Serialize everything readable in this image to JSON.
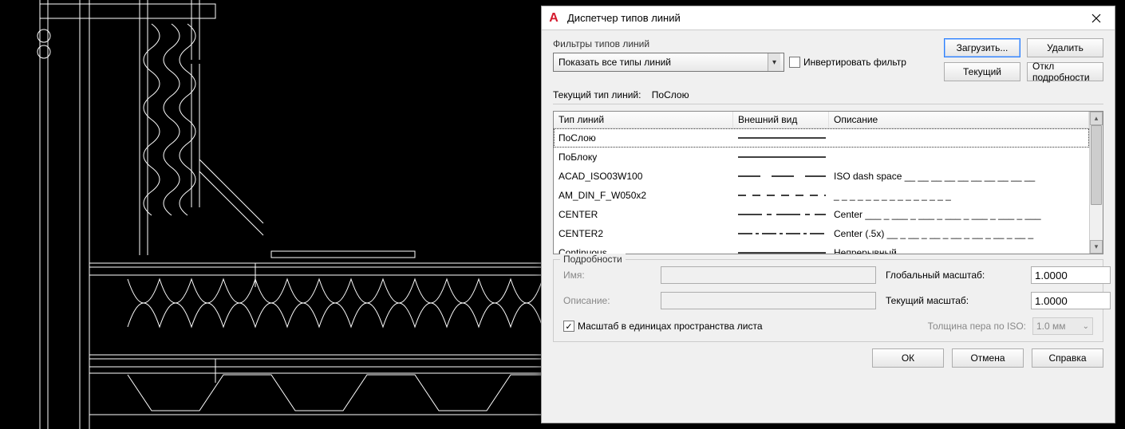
{
  "window": {
    "title": "Диспетчер типов линий",
    "app_icon_letter": "A"
  },
  "filters": {
    "group_label": "Фильтры типов линий",
    "selected": "Показать все типы линий",
    "invert_label": "Инвертировать фильтр",
    "invert_checked": false
  },
  "top_buttons": {
    "load": "Загрузить...",
    "delete": "Удалить",
    "current": "Текущий",
    "toggle_details": "Откл подробности"
  },
  "current_linetype": {
    "label": "Текущий тип линий:",
    "value": "ПоСлою"
  },
  "columns": {
    "name": "Тип линий",
    "appearance": "Внешний вид",
    "description": "Описание"
  },
  "linetypes": [
    {
      "name": "ПоСлою",
      "pattern": "solid",
      "description": "",
      "selected": true
    },
    {
      "name": "ПоБлоку",
      "pattern": "solid",
      "description": ""
    },
    {
      "name": "ACAD_ISO03W100",
      "pattern": "longdash",
      "description": "ISO dash space __ __ __ __ __ __ __ __ __ __"
    },
    {
      "name": "AM_DIN_F_W050x2",
      "pattern": "shortdash",
      "description": "_ _ _ _ _ _ _ _ _ _ _ _ _ _ _"
    },
    {
      "name": "CENTER",
      "pattern": "centerlong",
      "description": "Center ___ _ ___ _ ___ _ ___ _ ___ _ ___ _ ___"
    },
    {
      "name": "CENTER2",
      "pattern": "centershort",
      "description": "Center (.5x) __ _ __ _ __ _ __ _ __ _ __ _ __ _"
    },
    {
      "name": "Continuous",
      "pattern": "solid",
      "description": "Непрерывный"
    }
  ],
  "details": {
    "legend": "Подробности",
    "name_label": "Имя:",
    "name_value": "",
    "desc_label": "Описание:",
    "desc_value": "",
    "global_scale_label": "Глобальный масштаб:",
    "global_scale_value": "1.0000",
    "current_scale_label": "Текущий масштаб:",
    "current_scale_value": "1.0000",
    "paperspace_label": "Масштаб в единицах пространства листа",
    "paperspace_checked": true,
    "iso_label": "Толщина пера по ISO:",
    "iso_value": "1.0 мм"
  },
  "bottom": {
    "ok": "ОК",
    "cancel": "Отмена",
    "help": "Справка"
  }
}
